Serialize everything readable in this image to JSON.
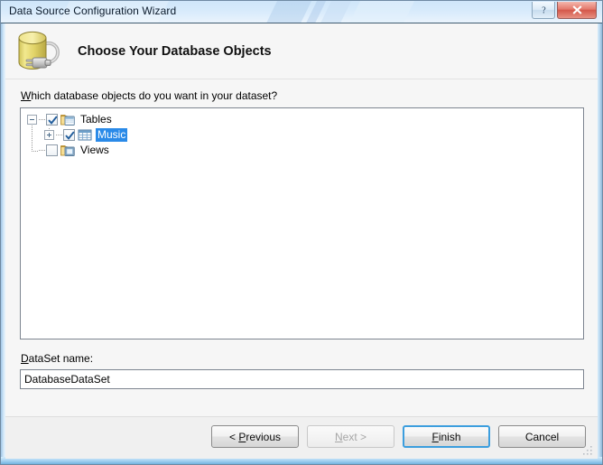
{
  "window": {
    "title": "Data Source Configuration Wizard",
    "titlebar_buttons": [
      {
        "name": "help-button",
        "label": "?",
        "icon": "question-mark-icon"
      },
      {
        "name": "close-button",
        "label": "✕",
        "icon": "close-icon"
      }
    ]
  },
  "header": {
    "title": "Choose Your Database Objects",
    "icon": "database-connection-icon"
  },
  "main": {
    "prompt": {
      "accel": "W",
      "rest": "hich database objects do you want in your dataset?"
    },
    "tree": {
      "nodes": [
        {
          "label": "Tables",
          "level": 0,
          "expander": "minus",
          "checkbox": "checked",
          "icon": "tables-folder-icon",
          "selected": false
        },
        {
          "label": "Music",
          "level": 1,
          "expander": "plus",
          "checkbox": "checked",
          "icon": "table-grid-icon",
          "selected": true
        },
        {
          "label": "Views",
          "level": 0,
          "expander": "none",
          "checkbox": "unchecked",
          "icon": "views-folder-icon",
          "selected": false
        }
      ]
    },
    "dataset": {
      "label_accel": "D",
      "label_rest": "ataSet name:",
      "value": "DatabaseDataSet",
      "placeholder": ""
    }
  },
  "footer": {
    "buttons": [
      {
        "name": "previous-button",
        "pre": "< ",
        "accel": "P",
        "post": "revious",
        "state": "enabled",
        "default": false
      },
      {
        "name": "next-button",
        "pre": "",
        "accel": "N",
        "post": "ext >",
        "state": "disabled",
        "default": false
      },
      {
        "name": "finish-button",
        "pre": "",
        "accel": "F",
        "post": "inish",
        "state": "enabled",
        "default": true
      },
      {
        "name": "cancel-button",
        "pre": "",
        "accel": "",
        "post": "Cancel",
        "state": "enabled",
        "default": false
      }
    ],
    "resize_grip": "resize-grip-icon"
  },
  "colors": {
    "selection_blue": "#2a8ae8",
    "default_button_border": "#3c9ede",
    "close_button_red": "#d4584b",
    "db_icon_yellow": "#e8dc78"
  }
}
